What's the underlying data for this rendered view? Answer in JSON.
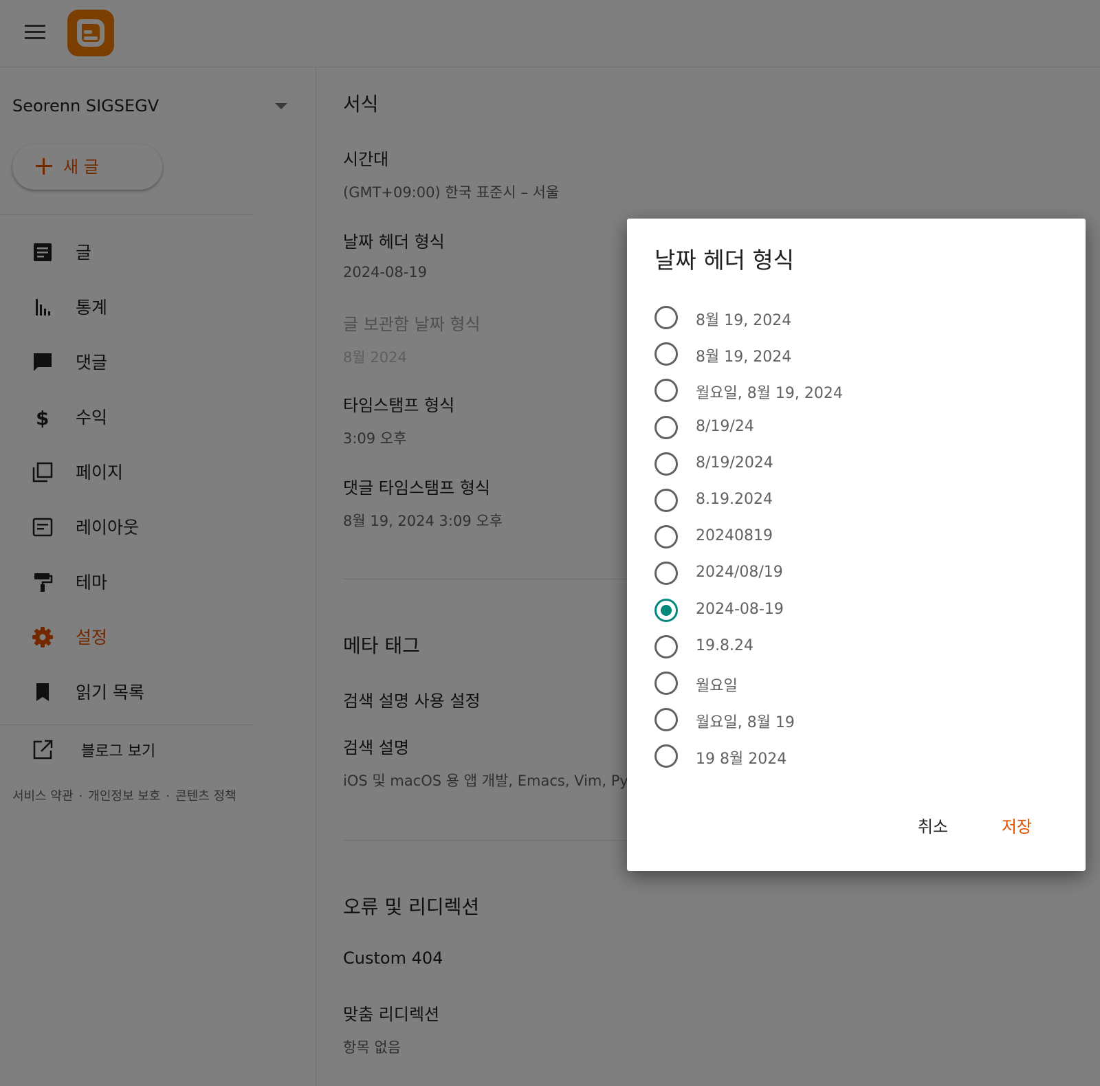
{
  "blog": {
    "name": "Seorenn SIGSEGV"
  },
  "sidebar": {
    "new_post_label": "새 글",
    "items": [
      {
        "label": "글",
        "icon": "posts-icon"
      },
      {
        "label": "통계",
        "icon": "stats-icon"
      },
      {
        "label": "댓글",
        "icon": "comments-icon"
      },
      {
        "label": "수익",
        "icon": "dollar-icon"
      },
      {
        "label": "페이지",
        "icon": "pages-icon"
      },
      {
        "label": "레이아웃",
        "icon": "layout-icon"
      },
      {
        "label": "테마",
        "icon": "paint-roller-icon"
      },
      {
        "label": "설정",
        "icon": "gear-icon",
        "active": true
      },
      {
        "label": "읽기 목록",
        "icon": "bookmark-icon"
      }
    ],
    "view_blog_label": "블로그 보기",
    "footer": {
      "terms": "서비스 약관",
      "privacy": "개인정보 보호",
      "content_policy": "콘텐츠 정책",
      "separator": "·"
    }
  },
  "main": {
    "format_section": {
      "title": "서식",
      "timezone": {
        "label": "시간대",
        "value": "(GMT+09:00) 한국 표준시 – 서울"
      },
      "date_header": {
        "label": "날짜 헤더 형식",
        "value": "2024-08-19"
      },
      "archive_date": {
        "label": "글 보관함 날짜 형식",
        "value": "8월 2024"
      },
      "timestamp": {
        "label": "타임스탬프 형식",
        "value": "3:09 오후"
      },
      "comment_timestamp": {
        "label": "댓글 타임스탬프 형식",
        "value": "8월 19, 2024 3:09 오후"
      }
    },
    "meta_section": {
      "title": "메타 태그",
      "enable_search_desc": {
        "label": "검색 설명 사용 설정"
      },
      "search_desc": {
        "label": "검색 설명",
        "value": "iOS 및 macOS 용 앱 개발, Emacs, Vim, Pyt"
      }
    },
    "errors_section": {
      "title": "오류 및 리디렉션",
      "custom404": {
        "label": "Custom 404"
      },
      "custom_redirects": {
        "label": "맞춤 리디렉션",
        "value": "항목 없음"
      }
    }
  },
  "dialog": {
    "title": "날짜 헤더 형식",
    "options": [
      "8월 19, 2024",
      "8월 19, 2024",
      "월요일, 8월 19, 2024",
      "8/19/24",
      "8/19/2024",
      "8.19.2024",
      "20240819",
      "2024/08/19",
      "2024-08-19",
      "19.8.24",
      "월요일",
      "월요일, 8월 19",
      "19 8월 2024"
    ],
    "selected_index": 8,
    "cancel_label": "취소",
    "save_label": "저장"
  },
  "colors": {
    "accent": "#e65100",
    "radio_checked": "#00897b",
    "brand": "#f57c00"
  }
}
